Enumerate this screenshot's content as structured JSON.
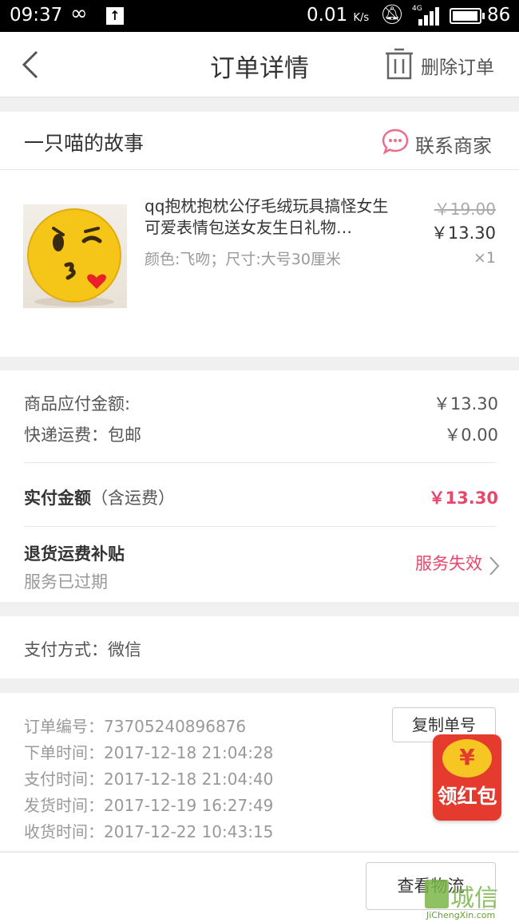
{
  "status_bar": {
    "time": "09:37",
    "speed": "0.01",
    "speed_unit": "K/s",
    "network": "4G",
    "battery": "86"
  },
  "nav": {
    "title": "订单详情",
    "delete_label": "删除订单"
  },
  "shop": {
    "name": "一只喵的故事",
    "contact_label": "联系商家"
  },
  "product": {
    "title": "qq抱枕抱枕公仔毛绒玩具搞怪女生可爱表情包送女友生日礼物…",
    "spec": "颜色:飞吻；尺寸:大号30厘米",
    "original_price": "￥19.00",
    "price": "￥13.30",
    "quantity": "×1"
  },
  "summary": {
    "goods_amount_label": "商品应付金额:",
    "goods_amount_value": "￥13.30",
    "shipping_label": "快递运费：包邮",
    "shipping_value": "￥0.00",
    "paid_label": "实付金额",
    "paid_note": "（含运费）",
    "paid_value": "￥13.30",
    "return_subsidy_label": "退货运费补贴",
    "return_subsidy_status": "服务已过期",
    "service_link": "服务失效"
  },
  "payment": {
    "method_label": "支付方式：微信"
  },
  "order_info": {
    "order_no": "订单编号：73705240896876",
    "order_time": "下单时间：2017-12-18  21:04:28",
    "pay_time": "支付时间：2017-12-18  21:04:40",
    "ship_time": "发货时间：2017-12-19  16:27:49",
    "receive_time": "收货时间：2017-12-22  10:43:15",
    "copy_button": "复制单号"
  },
  "footer": {
    "track_button": "查看物流"
  },
  "red_packet": {
    "coin": "¥",
    "label": "领红包"
  },
  "watermark": {
    "text": "城信",
    "url": "JiChengXin.com"
  },
  "colors": {
    "accent": "#e8476b",
    "contact_icon": "#f06b8a",
    "red_packet": "#e53b2f"
  }
}
